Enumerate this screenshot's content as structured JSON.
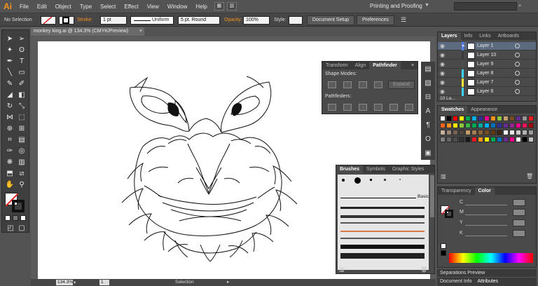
{
  "menubar": {
    "logo": "Ai",
    "items": [
      "File",
      "Edit",
      "Object",
      "Type",
      "Select",
      "Effect",
      "View",
      "Window",
      "Help"
    ],
    "workspace": "Printing and Proofing"
  },
  "control": {
    "selection": "No Selection",
    "stroke_label": "Stroke:",
    "stroke_value": "1 pt",
    "profile": "Uniform",
    "brush": "5 pt. Round",
    "opacity_label": "Opacity:",
    "opacity_value": "100%",
    "style_label": "Style:",
    "doc_setup": "Document Setup",
    "preferences": "Preferences"
  },
  "document": {
    "tab": "monkey king.ai @ 134.3% (CMYK/Preview)",
    "close": "×"
  },
  "status": {
    "zoom": "134.3%",
    "page": "1",
    "tool": "Selection"
  },
  "pathfinder": {
    "tabs": [
      "Transform",
      "Align",
      "Pathfinder"
    ],
    "shape_modes": "Shape Modes:",
    "expand": "Expand",
    "pathfinders": "Pathfinders:"
  },
  "brushes": {
    "tabs": [
      "Brushes",
      "Symbols",
      "Graphic Styles"
    ],
    "basic": "Basic"
  },
  "layers": {
    "tabs": [
      "Layers",
      "Info",
      "Links",
      "Artboards"
    ],
    "rows": [
      {
        "name": "Layer 1",
        "color": "#4f80ff"
      },
      {
        "name": "Layer 10",
        "color": "#3a3a3a"
      },
      {
        "name": "Layer 9",
        "color": "#4e4e4e"
      },
      {
        "name": "Layer 8",
        "color": "#3ad4ff"
      },
      {
        "name": "Layer 7",
        "color": "#ffe23a"
      },
      {
        "name": "Layer 6",
        "color": "#3ad4ff"
      }
    ],
    "footer": "10 La..."
  },
  "swatches": {
    "tabs": [
      "Swatches",
      "Appearance"
    ]
  },
  "color": {
    "tabs": [
      "Transparency",
      "Color"
    ],
    "channels": [
      "C",
      "M",
      "Y",
      "K"
    ]
  },
  "bottom_panels": {
    "separations": "Separations Preview",
    "doc_info": "Document Info",
    "attributes": "Attributes"
  },
  "colors": {
    "accent": "#f7931e",
    "chrome": "#535353",
    "panel": "#4a4a4a"
  }
}
